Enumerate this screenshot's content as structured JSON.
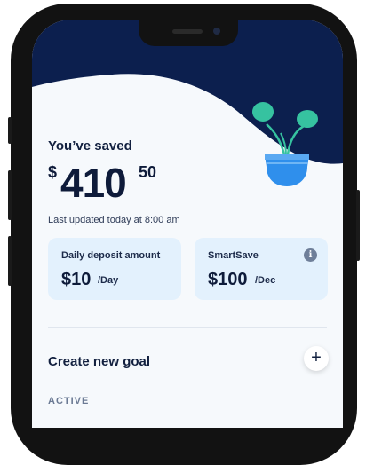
{
  "savings": {
    "label": "You’ve saved",
    "currency": "$",
    "amount_whole": "410",
    "amount_cents": "50",
    "last_updated": "Last updated today at 8:00 am"
  },
  "cards": {
    "daily_deposit": {
      "title": "Daily deposit amount",
      "value": "$10",
      "unit": "/Day"
    },
    "smartsave": {
      "title": "SmartSave",
      "value": "$100",
      "unit": "/Dec",
      "info_glyph": "i"
    }
  },
  "goals": {
    "create_label": "Create new goal",
    "add_glyph": "+",
    "active_label": "ACTIVE"
  },
  "icons": {
    "info": "info-icon",
    "plus": "plus-icon",
    "plant": "plant-illustration-icon"
  },
  "colors": {
    "header_navy": "#0c1f4e",
    "card_bg": "#e3f1fd",
    "text_dark": "#0e1b3a",
    "plant_leaf": "#36c2a0",
    "pot_blue": "#2f8fec"
  }
}
